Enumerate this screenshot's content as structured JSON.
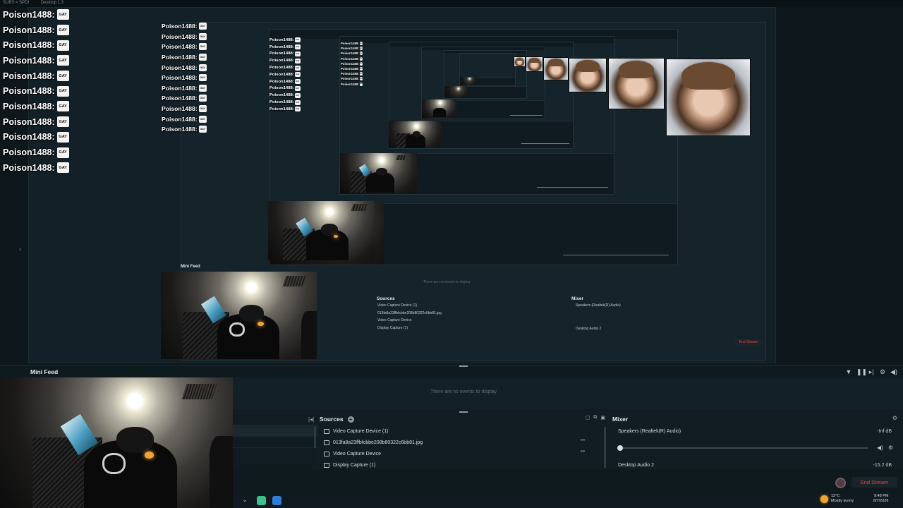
{
  "window": {
    "tab_left": "SUBS = SPDI",
    "tab_left2": "Desktop 1.3"
  },
  "chat": {
    "username": "Poison1488:",
    "badge": "GAY",
    "rows": 11,
    "rows_small": 11,
    "rows_tiny": 11,
    "rows_micro": 9
  },
  "dock": {
    "title": "Mini Feed",
    "events_empty": "There are no events to display"
  },
  "sources": {
    "title": "Sources",
    "items": [
      {
        "label": "Video Capture Device (1)",
        "linked": false
      },
      {
        "label": "013fa8a23ffbfcbbe208b80322c6bb81.jpg",
        "linked": true
      },
      {
        "label": "Video Capture Device",
        "linked": true
      },
      {
        "label": "Display Capture (1)",
        "linked": false
      }
    ]
  },
  "mixer": {
    "title": "Mixer",
    "channels": [
      {
        "name": "Speakers (Realtek(R) Audio)",
        "level": "-Inf dB"
      },
      {
        "name": "Desktop Audio 2",
        "level": "-15.2 dB"
      }
    ]
  },
  "controls": {
    "end_stream": "End Stream"
  },
  "taskbar": {
    "temperature": "12°C",
    "weather": "Mostly sunny",
    "time": "9:48 PM",
    "date": "8/7/2026"
  },
  "colors": {
    "accent_red": "#e8453f",
    "background": "#0d171c",
    "panel": "#121d23"
  }
}
